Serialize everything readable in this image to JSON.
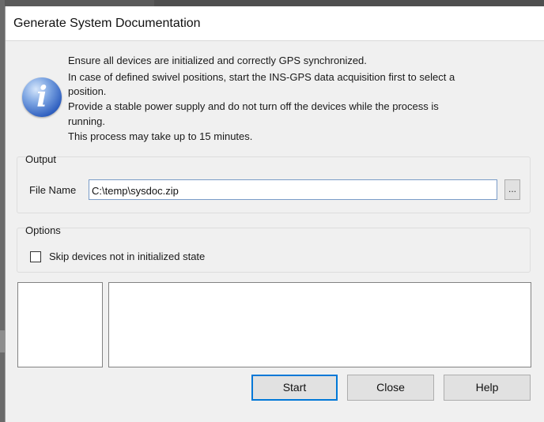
{
  "dialog": {
    "title": "Generate System Documentation",
    "message_lines": [
      "Ensure all devices are initialized and correctly GPS synchronized.",
      "In case of defined swivel positions, start the INS-GPS data acquisition first to select a",
      "position.",
      "Provide a stable power supply and do not turn off the devices while the process is",
      "running.",
      "This process may take up to 15 minutes."
    ],
    "icon": "info-icon"
  },
  "output": {
    "group_label": "Output",
    "file_name_label": "File Name",
    "file_name_value": "C:\\temp\\sysdoc.zip",
    "browse_label": "..."
  },
  "options": {
    "group_label": "Options",
    "skip_devices_label": "Skip devices not in initialized state",
    "skip_devices_checked": false
  },
  "buttons": {
    "start": "Start",
    "close": "Close",
    "help": "Help"
  }
}
